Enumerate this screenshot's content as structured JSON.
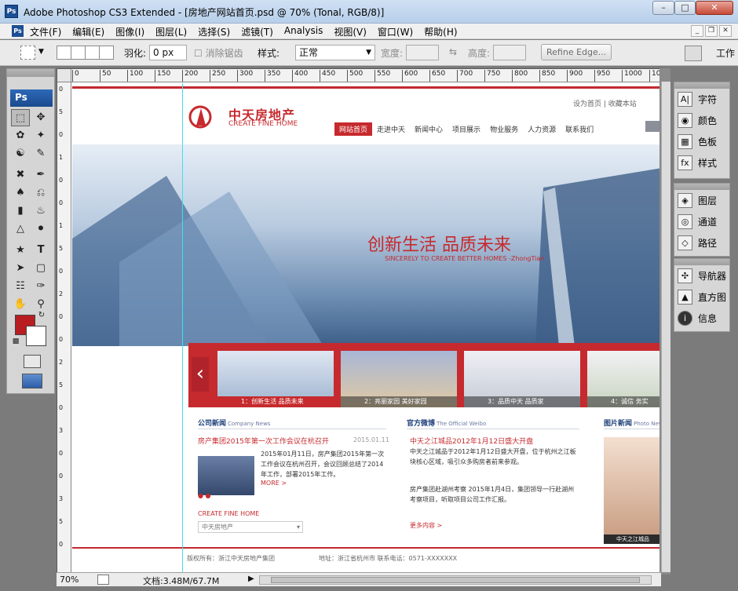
{
  "window": {
    "title": "Adobe Photoshop CS3 Extended - [房地产网站首页.psd @ 70% (Tonal, RGB/8)]",
    "app_icon": "Ps",
    "controls": [
      "minimize",
      "maximize",
      "close"
    ]
  },
  "menubar": {
    "doc_icon": "Ps",
    "items": [
      "文件(F)",
      "编辑(E)",
      "图像(I)",
      "图层(L)",
      "选择(S)",
      "滤镜(T)",
      "Analysis",
      "视图(V)",
      "窗口(W)",
      "帮助(H)"
    ]
  },
  "options": {
    "feather_label": "羽化:",
    "feather_value": "0 px",
    "antialias_label": "消除锯齿",
    "style_label": "样式:",
    "style_value": "正常",
    "width_label": "宽度:",
    "height_label": "高度:",
    "refine_edge": "Refine Edge...",
    "workspace": "工作"
  },
  "toolbox": {
    "badge": "Ps"
  },
  "colors": {
    "foreground": "#b81d22",
    "background": "#ffffff",
    "accent": "#c62a2e"
  },
  "panels": {
    "group1": [
      "字符",
      "颜色",
      "色板",
      "样式"
    ],
    "group2": [
      "图层",
      "通道",
      "路径"
    ],
    "group3": [
      "导航器",
      "直方图",
      "信息"
    ]
  },
  "ruler": {
    "top": [
      "0",
      "50",
      "100",
      "150",
      "200",
      "250",
      "300",
      "350",
      "400",
      "450",
      "500",
      "550",
      "600",
      "650",
      "700",
      "750",
      "800",
      "850",
      "900",
      "950",
      "1000",
      "10"
    ],
    "left": [
      "0",
      "5",
      "0",
      "1",
      "0",
      "0",
      "1",
      "5",
      "0",
      "2",
      "0",
      "0",
      "2",
      "5",
      "0",
      "3",
      "0",
      "0",
      "3",
      "5",
      "0"
    ]
  },
  "site": {
    "logo_cn": "中天房地产",
    "logo_en": "CREATE FINE HOME",
    "toplinks": "设为首页 | 收藏本站",
    "nav": [
      "网站首页",
      "走进中天",
      "新闻中心",
      "项目展示",
      "物业服务",
      "人力资源",
      "联系我们"
    ],
    "banner_slogan": "创新生活 品质未来",
    "banner_sub": "SINCERELY TO CREATE BETTER HOMES -ZhongTian",
    "thumbs": [
      "1：创新生活 品质未来",
      "2：亮丽家园 美好家园",
      "3：品质中天 品质家",
      "4：诚信 务实"
    ],
    "sections": [
      {
        "title": "公司新闻",
        "sub": "Company News"
      },
      {
        "title": "官方微博",
        "sub": "The Official Weibo"
      },
      {
        "title": "图片新闻",
        "sub": "Photo News"
      }
    ],
    "news_head": "房产集团2015年第一次工作会议在杭召开",
    "news_date": "2015.01.11",
    "news_text": "2015年01月11日，房产集团2015年第一次工作会议在杭州召开，会议回顾总结了2014年工作，部署2015年工作。",
    "news_more": "MORE >",
    "weibo1_head": "中天之江城品2012年1月12日盛大开盘",
    "weibo1_text": "中天之江城品于2012年1月12日盛大开盘，位于杭州之江板块核心区域，吸引众多购房者前来参观。",
    "weibo2_text": "房产集团赴湖州考察 2015年1月4日，集团领导一行赴湖州考察项目，听取项目公司工作汇报。",
    "weibo_more": "更多内容 >",
    "side_caption": "中天之江城品",
    "create_title": "CREATE FINE HOME",
    "create_select": "中天房地产",
    "footer": "版权所有：浙江中天房地产集团　　　　　　　地址：浙江省杭州市 联系电话：0571-XXXXXXX"
  },
  "status": {
    "zoom": "70%",
    "doc_size": "文档:3.48M/67.7M"
  }
}
